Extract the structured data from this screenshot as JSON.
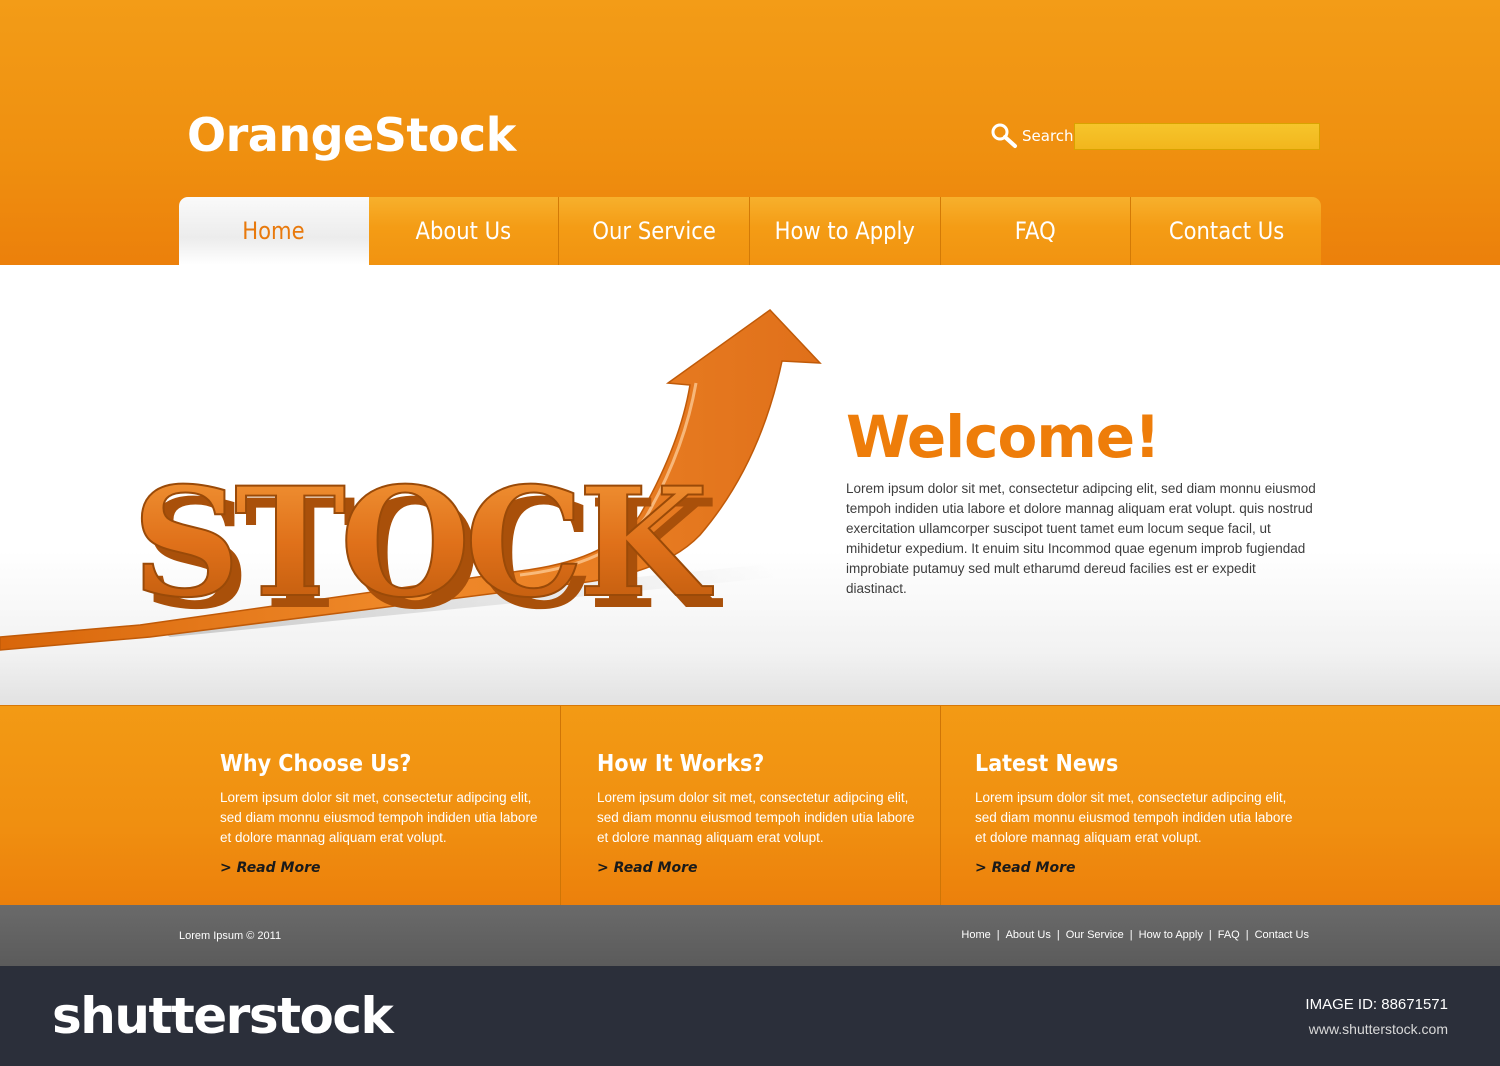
{
  "brand": {
    "logo": "OrangeStock"
  },
  "search": {
    "label": "Search",
    "value": ""
  },
  "nav": [
    {
      "label": "Home",
      "active": true
    },
    {
      "label": "About Us"
    },
    {
      "label": "Our Service"
    },
    {
      "label": "How to Apply"
    },
    {
      "label": "FAQ"
    },
    {
      "label": "Contact Us"
    }
  ],
  "hero": {
    "title": "Welcome!",
    "text": "Lorem ipsum dolor sit met, consectetur adipcing elit, sed diam monnu eiusmod tempoh indiden utia labore et dolore mannag aliquam erat volupt. quis nostrud exercitation ullamcorper suscipot tuent tamet eum locum seque facil, ut mihidetur expedium. It enuim situ Incommod quae egenum improb fugiendad improbiate putamuy sed mult etharumd dereud facilies est er expedit diastinact.",
    "graphic_word": "STOCK"
  },
  "features": [
    {
      "title": "Why Choose Us?",
      "text": "Lorem ipsum dolor sit met, consectetur adipcing elit, sed diam monnu eiusmod tempoh indiden utia labore et dolore mannag aliquam erat volupt.",
      "link": "> Read More"
    },
    {
      "title": "How It Works?",
      "text": "Lorem ipsum dolor sit met, consectetur adipcing elit, sed diam monnu eiusmod tempoh indiden utia labore et dolore mannag aliquam erat volupt.",
      "link": "> Read More"
    },
    {
      "title": "Latest News",
      "text": "Lorem ipsum dolor sit met, consectetur adipcing elit, sed diam monnu eiusmod tempoh indiden utia labore et dolore mannag aliquam erat volupt.",
      "link": "> Read More"
    }
  ],
  "footer": {
    "copyright": "Lorem Ipsum © 2011",
    "links": [
      "Home",
      "About Us",
      "Our Service",
      "How to Apply",
      "FAQ",
      "Contact Us"
    ],
    "separator": "|"
  },
  "stock_bar": {
    "brand": "shutterstock",
    "image_id_label": "IMAGE ID: 88671571",
    "url": "www.shutterstock.com"
  },
  "colors": {
    "orange": "#f0900f",
    "accent_text": "#ee7d0a",
    "footer_gray": "#5b5b5b",
    "stock_bar": "#2b2f3a"
  }
}
